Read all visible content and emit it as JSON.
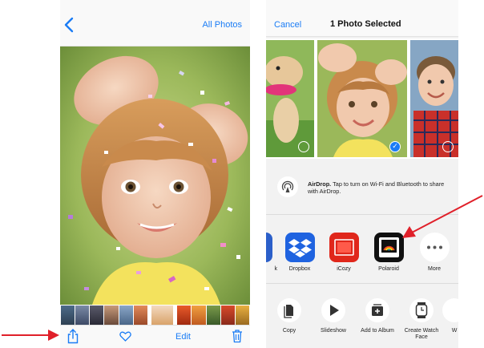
{
  "left_screen": {
    "nav": {
      "right_link": "All Photos"
    },
    "toolbar": {
      "edit_label": "Edit"
    }
  },
  "right_screen": {
    "nav": {
      "cancel_label": "Cancel",
      "title": "1 Photo Selected"
    },
    "airdrop": {
      "title": "AirDrop.",
      "text": "Tap to turn on Wi-Fi and Bluetooth to share with AirDrop."
    },
    "apps": [
      {
        "label": "Dropbox",
        "icon": "dropbox-icon"
      },
      {
        "label": "iCozy",
        "icon": "icozy-icon"
      },
      {
        "label": "Polaroid",
        "icon": "polaroid-icon"
      },
      {
        "label": "More",
        "icon": "more-icon"
      }
    ],
    "apps_partial_label": "k",
    "actions": [
      {
        "label": "Copy",
        "icon": "copy-icon"
      },
      {
        "label": "Slideshow",
        "icon": "play-icon"
      },
      {
        "label": "Add to Album",
        "icon": "add-album-icon"
      },
      {
        "label": "Create Watch Face",
        "icon": "watch-icon"
      }
    ],
    "actions_partial_label": "W"
  },
  "colors": {
    "ios_blue": "#1a7cf5",
    "arrow_red": "#e0202a",
    "dropbox_blue": "#1f63e0",
    "icozy_red": "#e0271b",
    "polaroid_black": "#111111"
  }
}
